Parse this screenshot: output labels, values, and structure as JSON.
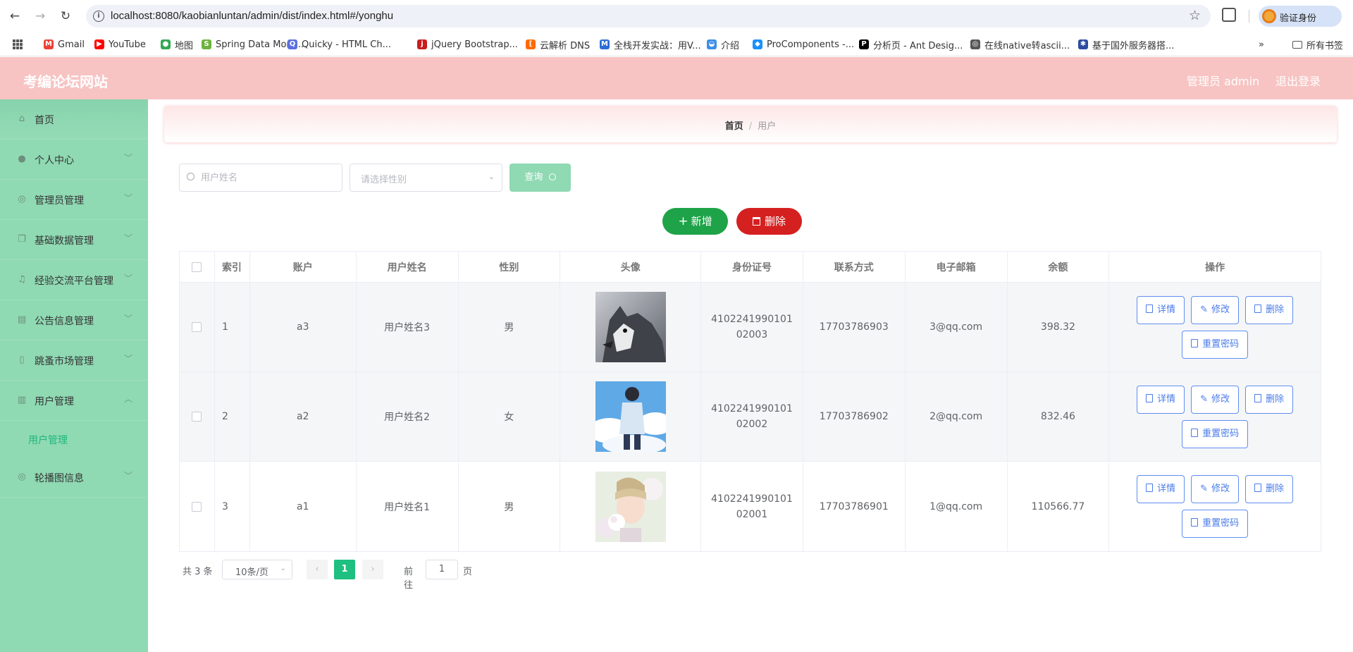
{
  "browser": {
    "url": "localhost:8080/kaobianluntan/admin/dist/index.html#/yonghu",
    "profile_label": "验证身份",
    "bookmarks": [
      {
        "label": "Gmail",
        "color": "#ea4335",
        "glyph": "M"
      },
      {
        "label": "YouTube",
        "color": "#ff0000",
        "glyph": "▶"
      },
      {
        "label": "地图",
        "color": "#34a853",
        "glyph": "●"
      },
      {
        "label": "Spring Data Mong...",
        "color": "#6db33f",
        "glyph": "S"
      },
      {
        "label": "Quicky - HTML Ch...",
        "color": "#5b6ee1",
        "glyph": "Q"
      },
      {
        "label": "jQuery Bootstrap...",
        "color": "#c81e1e",
        "glyph": "j"
      },
      {
        "label": "云解析 DNS",
        "color": "#ff6a00",
        "glyph": "["
      },
      {
        "label": "全栈开发实战：用V...",
        "color": "#2b6ed6",
        "glyph": "M"
      },
      {
        "label": "介绍",
        "color": "#3a8ee6",
        "glyph": "◒"
      },
      {
        "label": "ProComponents -...",
        "color": "#1890ff",
        "glyph": "◆"
      },
      {
        "label": "分析页 - Ant Desig...",
        "color": "#000000",
        "glyph": "P"
      },
      {
        "label": "在线native转ascii...",
        "color": "#555555",
        "glyph": "◎"
      },
      {
        "label": "基于国外服务器搭...",
        "color": "#2c4ba0",
        "glyph": "✱"
      }
    ],
    "more_label": "»",
    "all_bookmarks": "所有书签"
  },
  "header": {
    "title": "考编论坛网站",
    "admin": "管理员 admin",
    "logout": "退出登录"
  },
  "sidebar": {
    "items": [
      {
        "label": "首页",
        "icon": "home-icon",
        "glyph": "⌂"
      },
      {
        "label": "个人中心",
        "icon": "user-icon",
        "glyph": "●"
      },
      {
        "label": "管理员管理",
        "icon": "gear-icon",
        "glyph": "◎"
      },
      {
        "label": "基础数据管理",
        "icon": "copy-icon",
        "glyph": "❐"
      },
      {
        "label": "经验交流平台管理",
        "icon": "mic-icon",
        "glyph": "♫"
      },
      {
        "label": "公告信息管理",
        "icon": "clipboard-icon",
        "glyph": "▤"
      },
      {
        "label": "跳蚤市场管理",
        "icon": "phone-icon",
        "glyph": "▯"
      },
      {
        "label": "用户管理",
        "icon": "chart-icon",
        "glyph": "▥"
      }
    ],
    "sub_item": "用户管理",
    "last_item": {
      "label": "轮播图信息",
      "icon": "carousel-icon",
      "glyph": "◎"
    }
  },
  "breadcrumb": {
    "home": "首页",
    "separator": "/",
    "current": "用户"
  },
  "search": {
    "name_placeholder": "用户姓名",
    "gender_placeholder": "请选择性别",
    "query_label": "查询"
  },
  "actions": {
    "add_label": "新增",
    "delete_label": "删除"
  },
  "table": {
    "headers": [
      "索引",
      "账户",
      "用户姓名",
      "性别",
      "头像",
      "身份证号",
      "联系方式",
      "电子邮箱",
      "余额",
      "操作"
    ],
    "rows": [
      {
        "index": "1",
        "account": "a3",
        "name": "用户姓名3",
        "gender": "男",
        "avatar": "husky-dog",
        "id_card": "410224199010102003",
        "phone": "17703786903",
        "email": "3@qq.com",
        "balance": "398.32"
      },
      {
        "index": "2",
        "account": "a2",
        "name": "用户姓名2",
        "gender": "女",
        "avatar": "anime-boy-sky",
        "id_card": "410224199010102002",
        "phone": "17703786902",
        "email": "2@qq.com",
        "balance": "832.46"
      },
      {
        "index": "3",
        "account": "a1",
        "name": "用户姓名1",
        "gender": "男",
        "avatar": "boy-with-flowers",
        "id_card": "410224199010102001",
        "phone": "17703786901",
        "email": "1@qq.com",
        "balance": "110566.77"
      }
    ],
    "op_labels": {
      "detail": "详情",
      "edit": "修改",
      "delete": "删除",
      "reset": "重置密码"
    }
  },
  "pagination": {
    "total": "共 3 条",
    "page_size": "10条/页",
    "current_page": "1",
    "goto_label": "前往",
    "goto_value": "1",
    "page_suffix": "页"
  },
  "colors": {
    "header_bg": "#f7c4c3",
    "sidebar_bg": "#8fd9b3",
    "add_button": "#1ea348",
    "delete_button": "#d52020",
    "primary_link": "#4a7bea",
    "pager_active": "#1fbf80"
  }
}
